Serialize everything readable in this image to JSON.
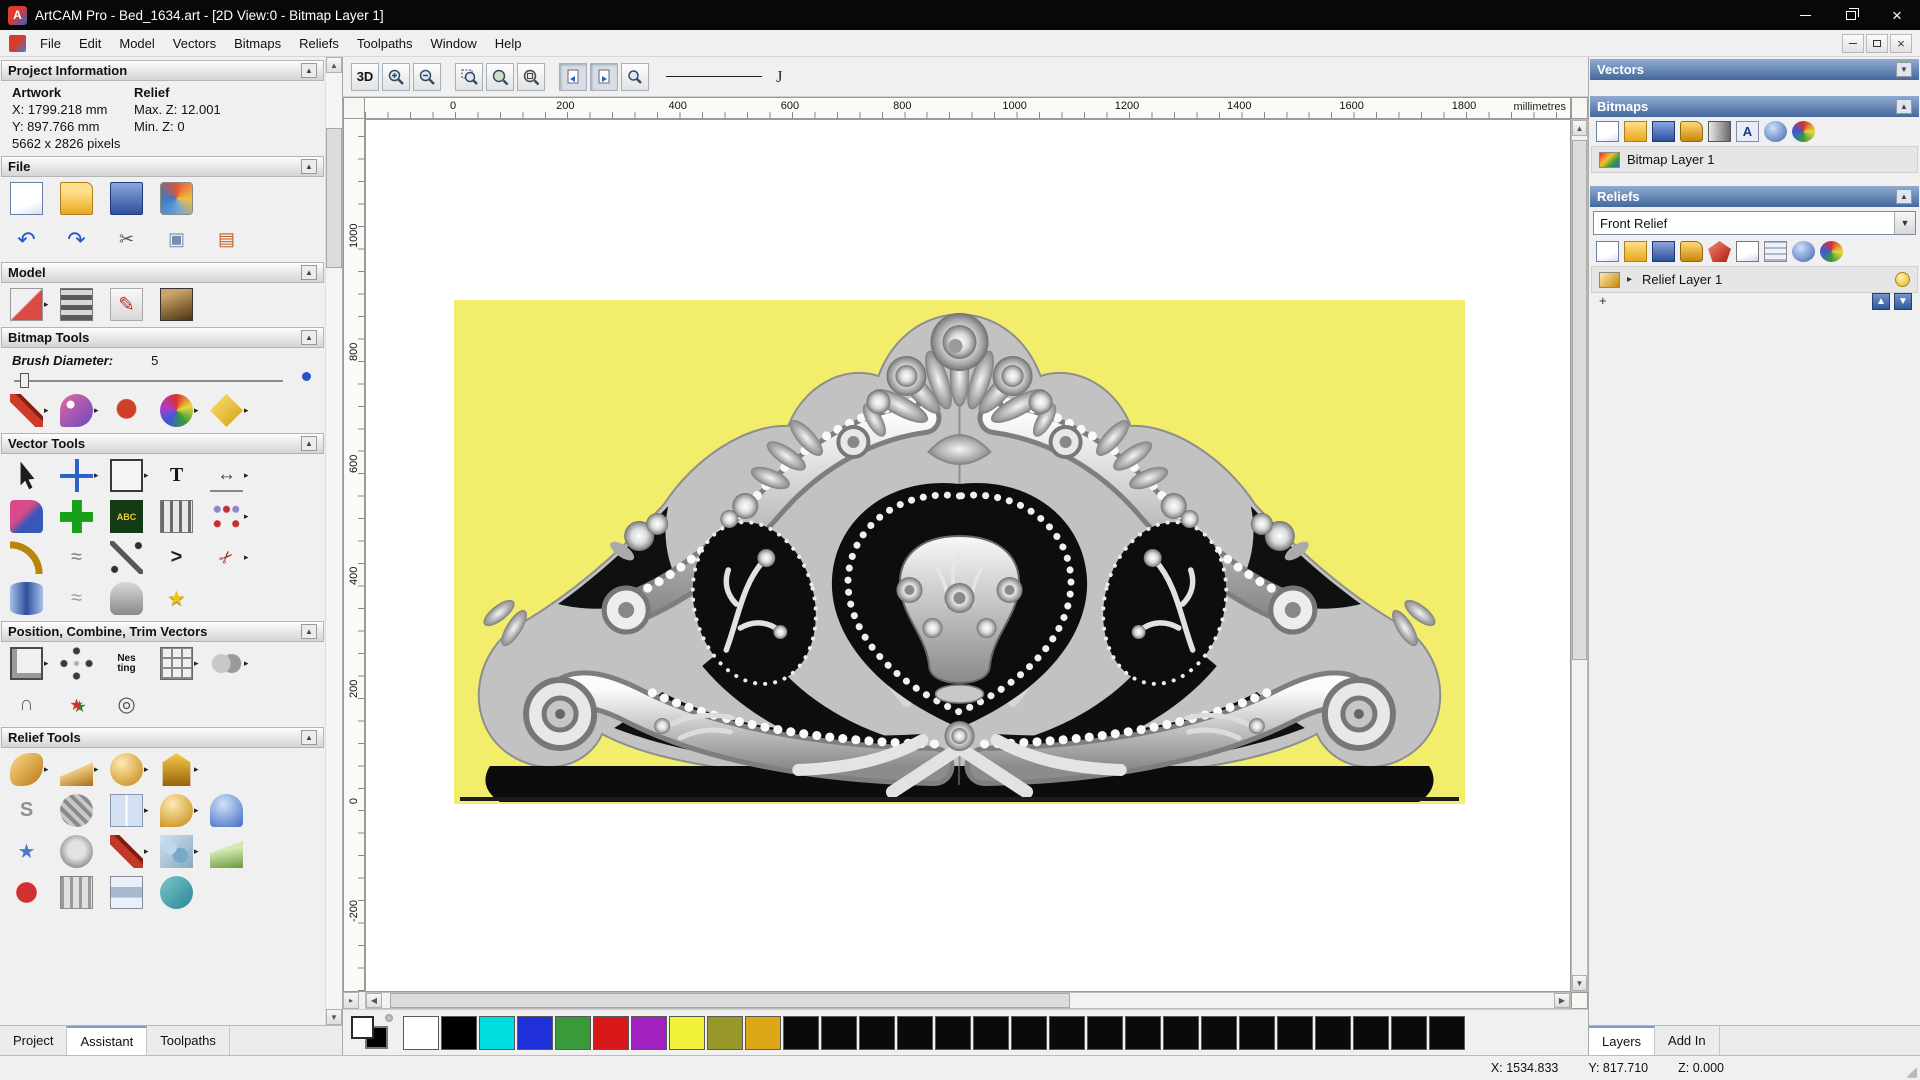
{
  "window": {
    "title": "ArtCAM Pro - Bed_1634.art - [2D View:0 - Bitmap Layer 1]"
  },
  "menu": {
    "items": [
      "File",
      "Edit",
      "Model",
      "Vectors",
      "Bitmaps",
      "Reliefs",
      "Toolpaths",
      "Window",
      "Help"
    ]
  },
  "left_panel": {
    "project_info": {
      "title": "Project Information",
      "col_artwork": "Artwork",
      "col_relief": "Relief",
      "x": "X: 1799.218 mm",
      "max_z": "Max. Z: 12.001",
      "y": "Y: 897.766 mm",
      "min_z": "Min. Z: 0",
      "pixels": "5662 x 2826 pixels"
    },
    "file": {
      "title": "File",
      "row1": [
        {
          "name": "new-model-icon",
          "style": "background:linear-gradient(160deg,#ffffff 65%,#d5e0f2);border:1px solid #6a7fa8"
        },
        {
          "name": "open-model-icon",
          "style": "background:linear-gradient(180deg,#ffdf8a 30%,#e8a71e);border:1px solid #a8811c;border-radius:2px 7px 2px 2px"
        },
        {
          "name": "save-model-icon",
          "style": "background:linear-gradient(180deg,#8ba5de,#2e519c);border:1px solid #1e3a78;border-radius:2px"
        },
        {
          "name": "model-wizard-icon",
          "style": "background:conic-gradient(#e05538,#f2c040,#68a0de,#3a7ac0,#e05538);border:1px solid #888;border-radius:4px"
        }
      ],
      "row2": [
        {
          "name": "undo-icon",
          "glyph": "↶",
          "style": "color:#2a52c8;font-size:22px"
        },
        {
          "name": "redo-icon",
          "glyph": "↷",
          "style": "color:#2a52c8;font-size:22px"
        },
        {
          "name": "cut-icon",
          "glyph": "✂",
          "style": "color:#555;font-size:18px"
        },
        {
          "name": "copy-icon",
          "glyph": "▣",
          "style": "color:#7a8ab0;font-size:18px"
        },
        {
          "name": "paste-icon",
          "glyph": "▤",
          "style": "color:#c45a28;font-size:18px"
        }
      ]
    },
    "model": {
      "title": "Model",
      "row": [
        {
          "name": "load-relief-icon",
          "style": "background:linear-gradient(135deg,#f0f0f0 48%,#d84a42 52%);border:1px solid #999",
          "fly": "▸"
        },
        {
          "name": "material-texture-icon",
          "style": "background:repeating-linear-gradient(0deg,#5a5a5a 0 5px,#d8d8d8 5px 10px),repeating-linear-gradient(90deg,rgba(90,90,90,0.55) 0 5px,rgba(216,216,216,0.55) 5px 10px);border:1px solid #777"
        },
        {
          "name": "edit-model-icon",
          "glyph": "✎",
          "style": "color:#c03028;font-size:20px;background:linear-gradient(180deg,#f8f8f8,#d8d8d8);border:1px solid #aaa"
        },
        {
          "name": "model-preview-icon",
          "style": "background:linear-gradient(160deg,#caa26a 20%,#8a6a3a 60%,#4a3418);border:1px solid #333"
        }
      ]
    },
    "bitmap_tools": {
      "title": "Bitmap Tools",
      "brush_label": "Brush Diameter:",
      "brush_value": "5",
      "row": [
        {
          "name": "paint-brush-icon",
          "style": "background:linear-gradient(45deg,transparent 38%,#d03a28 38% 58%,#8a1f14 58% 66%,transparent 66%)",
          "fly": "▸"
        },
        {
          "name": "paint-selective-icon",
          "style": "background:radial-gradient(circle at 32% 32%,#ffffff 12%,transparent 13%),linear-gradient(135deg,#e06a98,#6a48c8);border-radius:50% 50% 50% 10%",
          "fly": "▸"
        },
        {
          "name": "colour-picker-icon",
          "style": "background:radial-gradient(circle at 50% 45%,#d04028 38%,transparent 42%)"
        },
        {
          "name": "colour-palette-icon",
          "style": "background:conic-gradient(#d83030,#e8d83a,#3a9a3a,#3a5ad8,#b03ac8,#d83030);border-radius:50%",
          "fly": "▸"
        },
        {
          "name": "flood-fill-icon",
          "style": "background:linear-gradient(135deg,#ffe070,#d0a018);clip-path:polygon(50% 0,100% 50%,50% 100%,0 50%)",
          "fly": "▸"
        }
      ]
    },
    "vector_tools": {
      "title": "Vector Tools",
      "row1": [
        {
          "name": "select-vectors-icon",
          "style": "background:#1c1c1c;clip-path:polygon(32% 8%,32% 80%,46% 66%,58% 92%,68% 86%,56% 62%,74% 60%)"
        },
        {
          "name": "transform-vectors-icon",
          "style": "background:linear-gradient(#2a62c8,#2a62c8) 50% 0/12% 100% no-repeat,linear-gradient(#2a62c8,#2a62c8) 0 50%/100% 12% no-repeat",
          "fly": "▸"
        },
        {
          "name": "create-rectangle-icon",
          "style": "border:2px solid #383838;background:#f4f4f4",
          "fly": "▸"
        },
        {
          "name": "create-text-icon",
          "glyph": "T",
          "style": "color:#141414;font-weight:bold;font-size:20px;font-family:'Liberation Serif',serif"
        },
        {
          "name": "measure-icon",
          "glyph": "↔",
          "style": "color:#444;font-size:19px;border-bottom:2px solid #888",
          "fly": "▸"
        }
      ],
      "row2": [
        {
          "name": "offset-vectors-icon",
          "style": "background:linear-gradient(135deg,#d84a8a 40%,#3858b8 60%);border-radius:4px 12px 4px 4px"
        },
        {
          "name": "create-cross-icon",
          "style": "background:linear-gradient(#18a018,#18a018) 50% 0/30% 100% no-repeat,linear-gradient(#18a018,#18a018) 0 50%/100% 30% no-repeat"
        },
        {
          "name": "wrap-text-icon",
          "glyph": "ABC",
          "style": "background:#143a14;color:#f5c83a;font-size:9px;font-weight:bold"
        },
        {
          "name": "paste-along-curve-icon",
          "style": "background:repeating-linear-gradient(90deg,#6a6a6a 0 3px,#e8e8e8 3px 9px);border:1px solid #777"
        },
        {
          "name": "block-copy-icon",
          "style": "background:radial-gradient(circle at 22% 72%,#c03030 3px,transparent 4px),radial-gradient(circle at 50% 28%,#c03030 3px,transparent 4px),radial-gradient(circle at 78% 72%,#c03030 3px,transparent 4px),radial-gradient(circle at 78% 28%,#8888cc 3px,transparent 4px),radial-gradient(circle at 22% 28%,#8888cc 3px,transparent 4px)",
          "fly": "▸"
        }
      ],
      "row3": [
        {
          "name": "fit-arcs-icon",
          "style": "background:radial-gradient(circle at 0 100%,transparent 55%,#b8860b 55% 70%,transparent 70%)"
        },
        {
          "name": "free-smooth-icon",
          "glyph": "≈",
          "style": "color:#7a7a7a;font-size:20px"
        },
        {
          "name": "node-edit-icon",
          "style": "background:linear-gradient(45deg,transparent 44%,#585858 44% 56%,transparent 56%),radial-gradient(circle at 14% 86%,#303030 3px,transparent 4px),radial-gradient(circle at 86% 14%,#303030 3px,transparent 4px)"
        },
        {
          "name": "create-polyline-icon",
          "glyph": ">",
          "style": "color:#222;font-weight:bold;font-size:20px"
        },
        {
          "name": "trim-vectors-icon",
          "glyph": "✂",
          "style": "color:#a02828;font-size:17px;transform:rotate(-45deg)",
          "fly": "▸"
        }
      ],
      "row4": [
        {
          "name": "create-cylinder-icon",
          "style": "background:linear-gradient(90deg,#a8c0e8,#2e519c 50%,#a8c0e8);border-radius:45%/18%"
        },
        {
          "name": "distort-vectors-icon",
          "glyph": "≈",
          "style": "color:#9a9a9a;font-size:20px"
        },
        {
          "name": "vector-doctor-icon",
          "style": "background:linear-gradient(180deg,#d8d8d8,#8a8a8a);border-radius:45% 45% 20% 20%"
        },
        {
          "name": "create-star-icon",
          "glyph": "★",
          "style": "color:#f2c218;font-size:20px;text-shadow:0 1px 1px #8a6a00"
        }
      ]
    },
    "position_tools": {
      "title": "Position, Combine, Trim Vectors",
      "row1": [
        {
          "name": "align-vectors-icon",
          "style": "background:#f0f0f0;border:2px solid #4a4a4a;box-shadow:inset 5px -5px 0 #9a9a9a",
          "fly": "▸"
        },
        {
          "name": "circular-array-icon",
          "style": "background:radial-gradient(circle at 50% 12%,#3a3a3a 3px,transparent 4px),radial-gradient(circle at 88% 50%,#3a3a3a 3px,transparent 4px),radial-gradient(circle at 50% 88%,#3a3a3a 3px,transparent 4px),radial-gradient(circle at 12% 50%,#3a3a3a 3px,transparent 4px),radial-gradient(circle at 50% 50%,#b0b0b0 2px,transparent 3px)"
        },
        {
          "name": "nesting-icon",
          "glyph": "Nes\nting",
          "style": "white-space:pre;font-size:10px;font-weight:bold;line-height:1;color:#111"
        },
        {
          "name": "block-array-icon",
          "style": "background:repeating-linear-gradient(0deg,#8a8a8a 0 2px,transparent 2px 10px),repeating-linear-gradient(90deg,#8a8a8a 0 2px,transparent 2px 10px);border:1px solid #666",
          "fly": "▸"
        },
        {
          "name": "weld-vectors-icon",
          "style": "background:radial-gradient(circle at 34% 50%,#c8c8c8 9px,transparent 10px),radial-gradient(circle at 66% 50%,#9a9a9a 9px,transparent 10px)",
          "fly": "▸"
        }
      ],
      "row2": [
        {
          "name": "slice-vectors-icon",
          "glyph": "∩",
          "style": "color:#666;font-size:20px"
        },
        {
          "name": "interactive-trim-icon",
          "glyph": "★",
          "style": "color:#d03030;font-size:16px;text-shadow:3px 2px 0 #2a8a2a"
        },
        {
          "name": "create-spiral-icon",
          "glyph": "◎",
          "style": "color:#555;font-size:21px"
        }
      ]
    },
    "relief_tools": {
      "title": "Relief Tools",
      "row1": [
        {
          "name": "sculpt-relief-icon",
          "style": "background:linear-gradient(135deg,#ffd98a,#b87812);border-radius:60% 25% 60% 25%",
          "fly": "▸"
        },
        {
          "name": "smooth-relief-icon",
          "style": "background:linear-gradient(160deg,#ffe2a0 40%,#a86e10);clip-path:polygon(0 72%,100% 28%,100% 100%,0 100%)",
          "fly": "▸"
        },
        {
          "name": "shape-editor-icon",
          "style": "background:radial-gradient(circle at 35% 30%,#ffeab2,#c2850c);border-radius:50%",
          "fly": "▸"
        },
        {
          "name": "extrude-relief-icon",
          "style": "background:linear-gradient(180deg,#f8cc4a,#96620c);clip-path:polygon(50% 0,92% 28%,92% 100%,8% 100%,8% 28%)",
          "fly": "▸"
        }
      ],
      "row2": [
        {
          "name": "sweep-profile-icon",
          "glyph": "S",
          "style": "color:#909090;font-size:20px;font-weight:bold"
        },
        {
          "name": "texture-relief-icon",
          "style": "background:repeating-linear-gradient(45deg,#c8c8c8 0 4px,#8a8a8a 4px 8px);border-radius:50%"
        },
        {
          "name": "relief-from-image-icon",
          "style": "background:linear-gradient(90deg,#d2e0f2 46%,#ffffff 46% 54%,#d2e0f2 54%);border:1px solid #8898b0",
          "fly": "▸"
        },
        {
          "name": "two-rail-sweep-icon",
          "style": "background:radial-gradient(circle at 38% 30%,#ffeab2,#c2850c);border-radius:50% 50% 50% 0",
          "fly": "▸"
        },
        {
          "name": "dome-relief-icon",
          "style": "background:radial-gradient(circle at 40% 30%,#d2e2fa,#3f6cc0);border-radius:50% 50% 12% 12%"
        }
      ],
      "row3": [
        {
          "name": "star-relief-icon",
          "glyph": "★",
          "style": "color:#4a7ad0;font-size:20px"
        },
        {
          "name": "face-wizard-icon",
          "style": "background:radial-gradient(circle at 50% 45%,#e2e2e2 35%,#9a9a9a 70%);border-radius:50%"
        },
        {
          "name": "paint-relief-icon",
          "style": "background:linear-gradient(45deg,transparent 36%,#c03828 36% 56%,#801c10 56% 64%,transparent 64%)",
          "fly": "▸"
        },
        {
          "name": "texture-flow-icon",
          "style": "background:radial-gradient(circle at 30% 38%,#bcd8ea 22%,transparent 23%),radial-gradient(circle at 62% 62%,#78aac8 26%,transparent 27%),linear-gradient(135deg,#d0e2ee,#88a8c0)",
          "fly": "▸"
        },
        {
          "name": "angled-plane-icon",
          "style": "background:linear-gradient(170deg,#d2eab2 45%,#6a9a3c);clip-path:polygon(0 55%,100% 18%,100% 100%,0 100%)"
        }
      ],
      "row4": [
        {
          "name": "isolate-relief-icon",
          "style": "background:radial-gradient(circle,#d03030 42%,transparent 46%)"
        },
        {
          "name": "relief-fence-icon",
          "style": "background:repeating-linear-gradient(90deg,#9a9a9a 0 3px,#e0e0e0 3px 9px);border:1px solid #888"
        },
        {
          "name": "relief-layer-stack-icon",
          "style": "background:linear-gradient(#e8f0fa 33%,#a8b8d0 33% 66%,#e8f0fa 66%);border:1px solid #889"
        },
        {
          "name": "relief-clay-icon",
          "style": "background:linear-gradient(135deg,#7ac8cc,#2a8694);border-radius:50%"
        }
      ]
    },
    "tabs": [
      {
        "label": "Project",
        "active": "false",
        "name": "tab-project"
      },
      {
        "label": "Assistant",
        "active": "true",
        "name": "tab-assistant"
      },
      {
        "label": "Toolpaths",
        "active": "false",
        "name": "tab-toolpaths"
      }
    ]
  },
  "canvas": {
    "toolbar": {
      "view3d": "3D"
    },
    "h_ruler": [
      "0",
      "200",
      "400",
      "600",
      "800",
      "1000",
      "1200",
      "1400",
      "1600",
      "1800"
    ],
    "ruler_unit": "millimetres",
    "v_ruler": [
      "1000",
      "800",
      "600",
      "400",
      "200",
      "0",
      "-200"
    ]
  },
  "right_panel": {
    "vectors_title": "Vectors",
    "bitmaps_title": "Bitmaps",
    "bitmaps_toolbar": [
      {
        "name": "new-bitmap-icon",
        "style": "background:linear-gradient(160deg,#ffffff 65%,#d5e0f2);border:1px solid #6a7fa8"
      },
      {
        "name": "open-bitmap-icon",
        "style": "background:linear-gradient(180deg,#ffdf8a,#e8a71e);border:1px solid #a8811c"
      },
      {
        "name": "save-bitmap-icon",
        "style": "background:linear-gradient(180deg,#8ba5de,#2e519c);border:1px solid #1e3a78"
      },
      {
        "name": "merge-bitmap-icon",
        "style": "background:linear-gradient(180deg,#ffd977,#c8860a);border:1px solid #906a10;border-radius:3px 8px 3px 3px"
      },
      {
        "name": "greyscale-bitmap-icon",
        "style": "background:linear-gradient(90deg,#e8e8e8,#6a6a6a);border:1px solid #555"
      },
      {
        "name": "edit-bitmap-icon",
        "glyph": "A",
        "style": "background:#e8eef8;border:1px solid #88a;color:#1a3a8a;font-weight:bold;font-size:13px"
      },
      {
        "name": "delete-bitmap-icon",
        "style": "background:radial-gradient(circle at 38% 32%,#cfe0f8,#3a62b0);border-radius:50%"
      },
      {
        "name": "bitmap-colours-icon",
        "style": "background:conic-gradient(#d83030,#e8d83a,#3a9a3a,#3a5ad8,#d83030);border-radius:50%"
      }
    ],
    "bitmap_layer": {
      "label": "Bitmap Layer 1",
      "thumb_style": "background:linear-gradient(135deg,#e83030,#f2c030 40%,#3a9a3a 70%,#3a5ad8)"
    },
    "reliefs_title": "Reliefs",
    "relief_combo": {
      "value": "Front Relief"
    },
    "reliefs_toolbar": [
      {
        "name": "new-relief-icon",
        "style": "background:linear-gradient(160deg,#ffffff 65%,#d5e0f2);border:1px solid #6a7fa8"
      },
      {
        "name": "open-relief-icon",
        "style": "background:linear-gradient(180deg,#ffdf8a,#e8a71e);border:1px solid #a8811c"
      },
      {
        "name": "save-relief-icon",
        "style": "background:linear-gradient(180deg,#8ba5de,#2e519c);border:1px solid #1e3a78"
      },
      {
        "name": "merge-relief-icon",
        "style": "background:linear-gradient(180deg,#ffd977,#c8860a);border:1px solid #906a10;border-radius:3px 8px 3px 3px"
      },
      {
        "name": "scale-relief-icon",
        "style": "background:linear-gradient(135deg,#f08a7a,#b01808);clip-path:polygon(50% 0,100% 38%,80% 100%,20% 100%,0 38%)"
      },
      {
        "name": "calculate-relief-icon",
        "style": "background:linear-gradient(160deg,#ffffff 60%,#cfd8ea);border:1px solid #777"
      },
      {
        "name": "reset-relief-icon",
        "style": "background:repeating-linear-gradient(0deg,#aabbcc 0 2px,#eef2f8 2px 6px);border:1px solid #889"
      },
      {
        "name": "delete-relief-icon",
        "style": "background:radial-gradient(circle at 38% 32%,#cfe0f8,#3a62b0);border-radius:50%"
      },
      {
        "name": "relief-colours-icon",
        "style": "background:conic-gradient(#d83030,#e8d83a,#3a9a3a,#3a5ad8,#d83030);border-radius:50%"
      }
    ],
    "relief_layer": {
      "label": "Relief Layer 1",
      "expander": "▸",
      "thumb_style": "background:linear-gradient(135deg,#ffe9b0,#c8860a)",
      "add_label": "+"
    },
    "up_glyph": "▲",
    "down_glyph": "▼",
    "tabs": [
      {
        "label": "Layers",
        "active": "true",
        "name": "tab-layers"
      },
      {
        "label": "Add In",
        "active": "false",
        "name": "tab-add-in"
      }
    ]
  },
  "palette": {
    "colors": [
      "#ffffff",
      "#000000",
      "#00dde0",
      "#2030d8",
      "#3a9a3a",
      "#d81818",
      "#a020c0",
      "#f2f23a",
      "#98982a",
      "#dca818",
      "#0a0a0a",
      "#0a0a0a",
      "#0a0a0a",
      "#0a0a0a",
      "#0a0a0a",
      "#0a0a0a",
      "#0a0a0a",
      "#0a0a0a",
      "#0a0a0a",
      "#0a0a0a",
      "#0a0a0a",
      "#0a0a0a",
      "#0a0a0a",
      "#0a0a0a",
      "#0a0a0a",
      "#0a0a0a",
      "#0a0a0a",
      "#0a0a0a"
    ]
  },
  "status_bar": {
    "x": "X: 1534.833",
    "y": "Y: 817.710",
    "z": "Z: 0.000"
  }
}
